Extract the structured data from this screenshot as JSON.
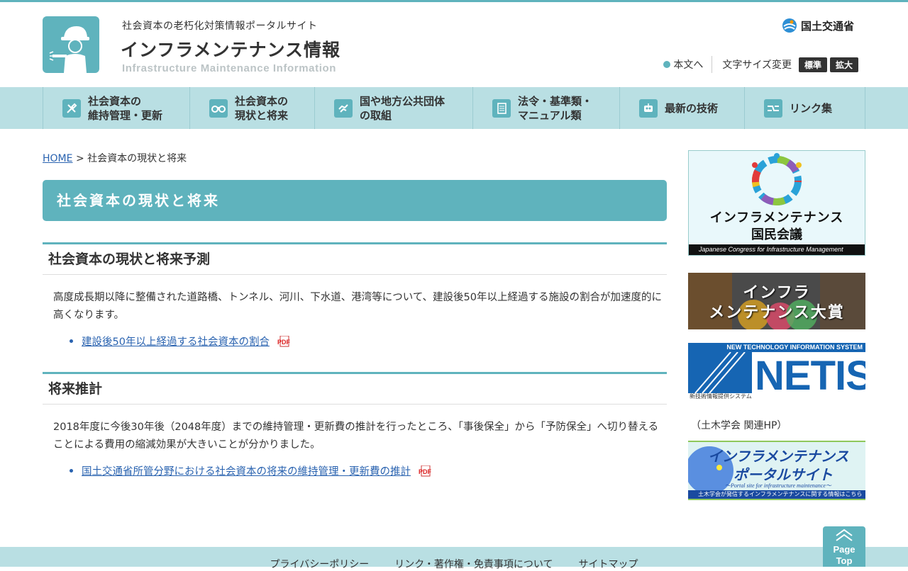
{
  "header": {
    "subtitle": "社会資本の老朽化対策情報ポータルサイト",
    "title": "インフラメンテナンス情報",
    "title_en": "Infrastructure Maintenance Information",
    "ministry": "国土交通省",
    "skip_link": "本文へ",
    "font_size_label": "文字サイズ変更",
    "font_standard": "標準",
    "font_large": "拡大"
  },
  "nav": {
    "items": [
      {
        "label": "社会資本の\n維持管理・更新",
        "icon": "tools-icon"
      },
      {
        "label": "社会資本の\n現状と将来",
        "icon": "binoculars-icon"
      },
      {
        "label": "国や地方公共団体\nの取組",
        "icon": "handshake-icon"
      },
      {
        "label": "法令・基準類・\nマニュアル類",
        "icon": "document-icon"
      },
      {
        "label": "最新の技術",
        "icon": "robot-icon"
      },
      {
        "label": "リンク集",
        "icon": "link-icon"
      }
    ]
  },
  "breadcrumb": {
    "home": "HOME",
    "sep": ">",
    "current": "社会資本の現状と将来"
  },
  "page_title": "社会資本の現状と将来",
  "sections": [
    {
      "heading": "社会資本の現状と将来予測",
      "text": "高度成長期以降に整備された道路橋、トンネル、河川、下水道、港湾等について、建設後50年以上経過する施設の割合が加速度的に高くなります。",
      "link": "建設後50年以上経過する社会資本の割合"
    },
    {
      "heading": "将来推計",
      "text": "2018年度に今後30年後（2048年度）までの維持管理・更新費の推計を行ったところ、「事後保全」から「予防保全」へ切り替えることによる費用の縮減効果が大きいことが分かりました。",
      "link": "国土交通省所管分野における社会資本の将来の維持管理・更新費の推計"
    }
  ],
  "pdf_label": "PDF",
  "sidebar": {
    "banner1": {
      "line1": "インフラメンテナンス",
      "line2": "国民会議",
      "en": "Japanese Congress for Infrastructure Management"
    },
    "banner2": {
      "line1": "インフラ",
      "line2": "メンテナンス大賞"
    },
    "banner3": {
      "top": "NEW TECHNOLOGY INFORMATION SYSTEM",
      "name": "NETIS",
      "jp": "新技術情報提供システム"
    },
    "note": "（土木学会 関連HP）",
    "banner4": {
      "line1": "インフラメンテナンス",
      "line2": "ポータルサイト",
      "en": "～Portal site for infrastructure maintenance～",
      "jp": "土木学会が発信するインフラメンテナンスに関する情報はこちら"
    }
  },
  "footer": {
    "links": [
      "プライバシーポリシー",
      "リンク・著作権・免責事項について",
      "サイトマップ"
    ],
    "pagetop_1": "Page",
    "pagetop_2": "Top"
  },
  "colors": {
    "accent": "#5fb3bd",
    "nav_bg": "#b9dfe3",
    "link": "#2a63b0"
  }
}
